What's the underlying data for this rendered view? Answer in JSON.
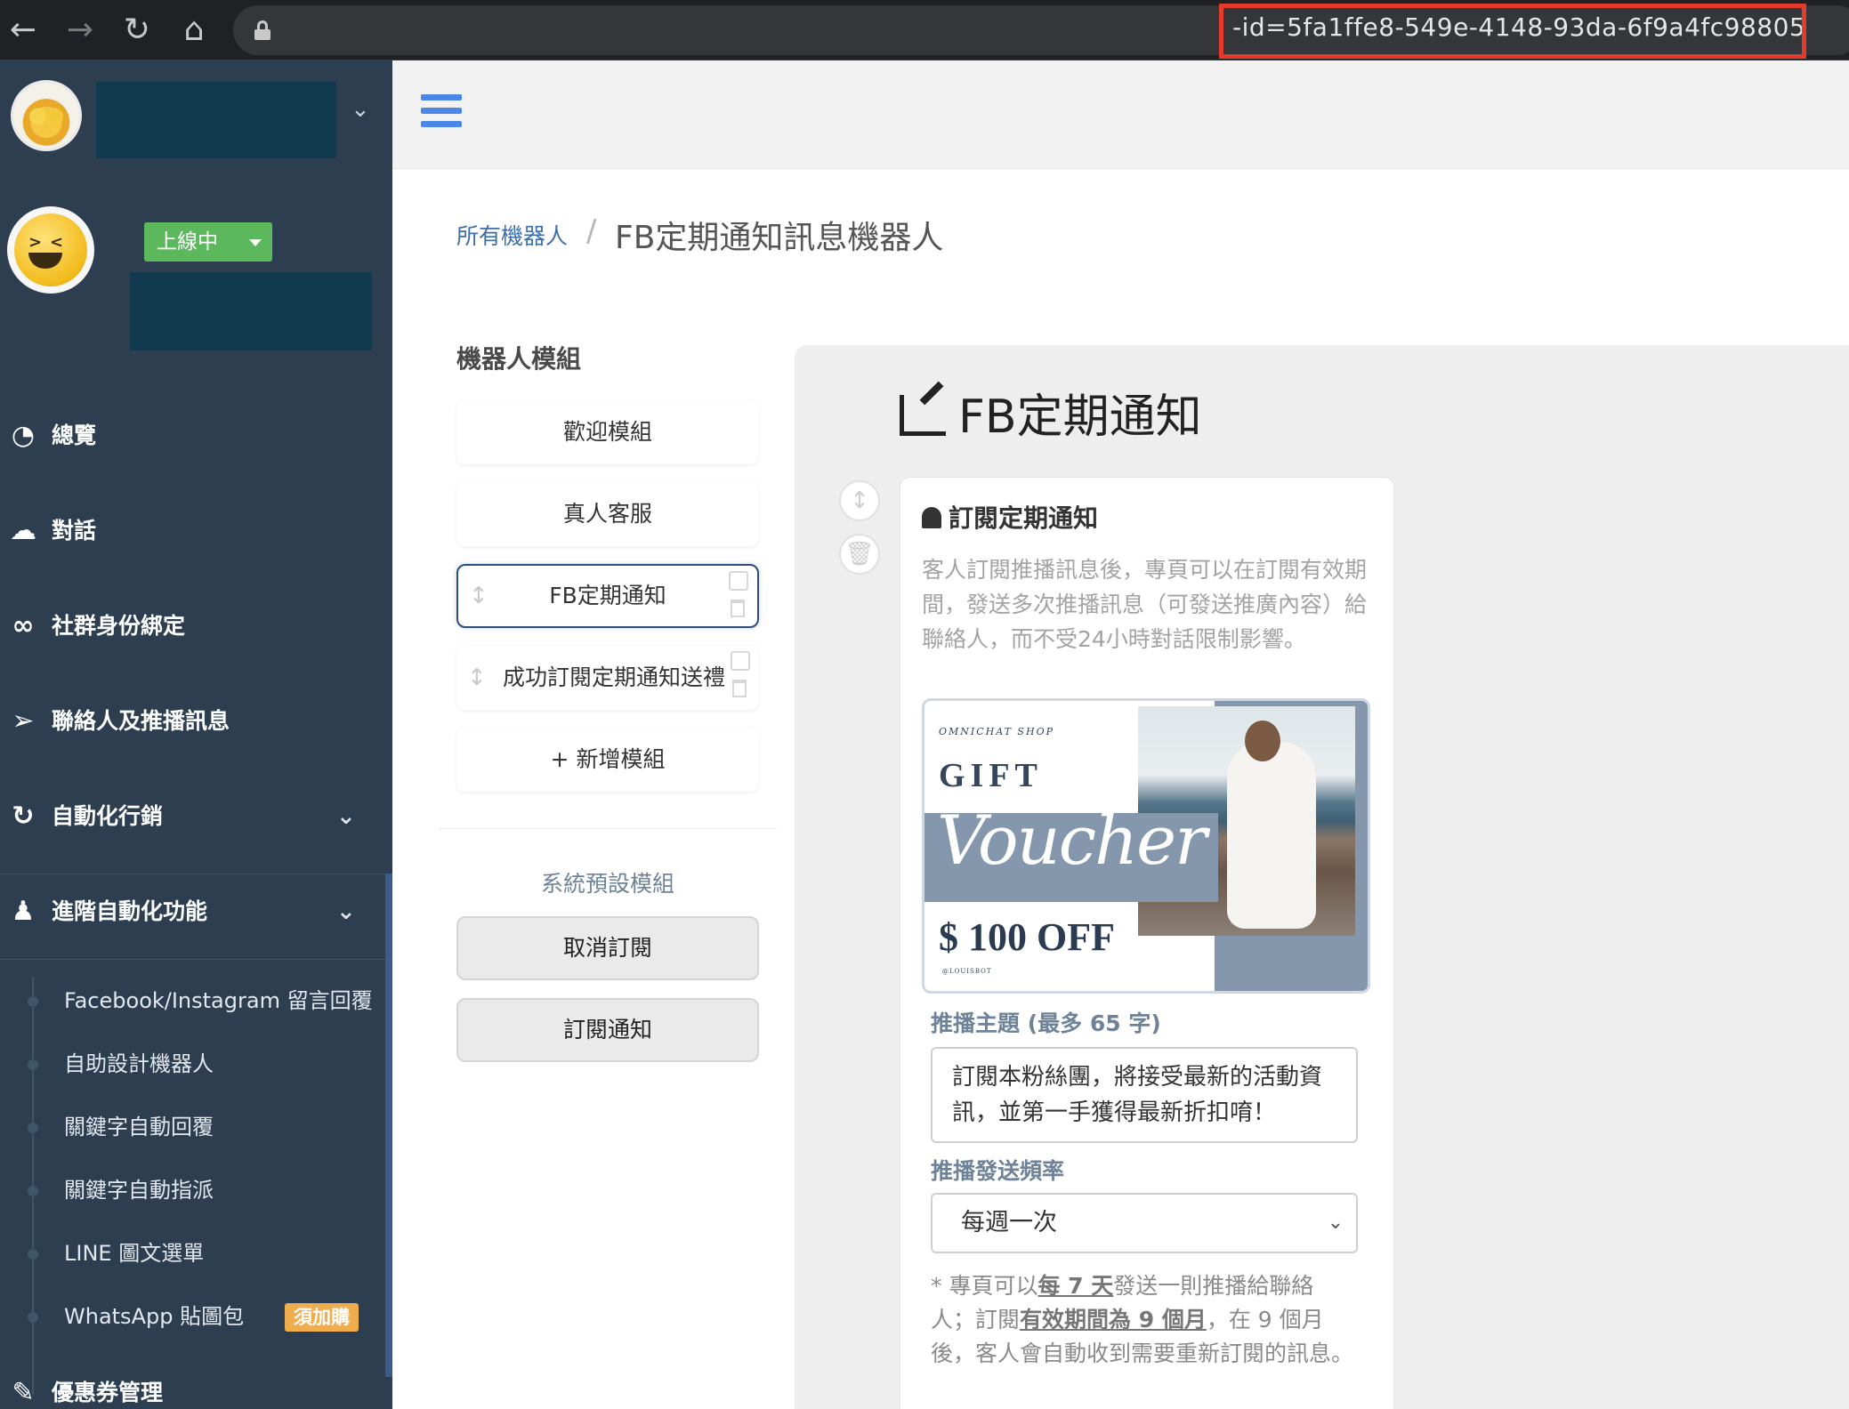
{
  "browser": {
    "url_fragment": "-id=5fa1ffe8-549e-4148-93da-6f9a4fc98805"
  },
  "sidebar": {
    "status_label": "上線中",
    "menu": [
      {
        "label": "總覽",
        "icon": "dashboard-icon"
      },
      {
        "label": "對話",
        "icon": "chat-icon"
      },
      {
        "label": "社群身份綁定",
        "icon": "link-icon"
      },
      {
        "label": "聯絡人及推播訊息",
        "icon": "paper-plane-icon"
      },
      {
        "label": "自動化行銷",
        "icon": "refresh-icon"
      },
      {
        "label": "進階自動化功能",
        "icon": "android-icon"
      }
    ],
    "submenu": [
      {
        "label": "Facebook/Instagram 留言回覆"
      },
      {
        "label": "自助設計機器人"
      },
      {
        "label": "關鍵字自動回覆"
      },
      {
        "label": "關鍵字自動指派"
      },
      {
        "label": "LINE 圖文選單"
      },
      {
        "label": "WhatsApp 貼圖包",
        "badge": "須加購"
      }
    ],
    "coupon": {
      "label": "優惠券管理"
    }
  },
  "breadcrumb": {
    "parent": "所有機器人",
    "separator": "/",
    "current": "FB定期通知訊息機器人"
  },
  "modules": {
    "title": "機器人模組",
    "items": [
      "歡迎模組",
      "真人客服",
      "FB定期通知",
      "成功訂閱定期通知送禮"
    ],
    "add_label": "+ 新增模組",
    "system_title": "系統預設模組",
    "system_items": [
      "取消訂閱",
      "訂閱通知"
    ]
  },
  "editor": {
    "title": "FB定期通知",
    "card_title": "訂閱定期通知",
    "description": "客人訂閱推播訊息後，專頁可以在訂閱有效期間，發送多次推播訊息（可發送推廣內容）給聯絡人，而不受24小時對話限制影響。",
    "voucher": {
      "shop": "OMNICHAT SHOP",
      "gift": "GIFT",
      "script": "Voucher",
      "price": "$ 100 OFF",
      "tag": "@LOUISBOT"
    },
    "topic_label": "推播主題 (最多 65 字)",
    "topic_value": "訂閱本粉絲團，將接受最新的活動資訊，並第一手獲得最新折扣唷！",
    "frequency_label": "推播發送頻率",
    "frequency_value": "每週一次",
    "note_prefix": "* 專頁可以",
    "note_freq": "每 7 天",
    "note_mid1": "發送一則推播給聯絡人；訂閱",
    "note_valid": "有效期間為 9 個月",
    "note_suffix": "，在 9 個月後，客人會自動收到需要重新訂閱的訊息。"
  }
}
